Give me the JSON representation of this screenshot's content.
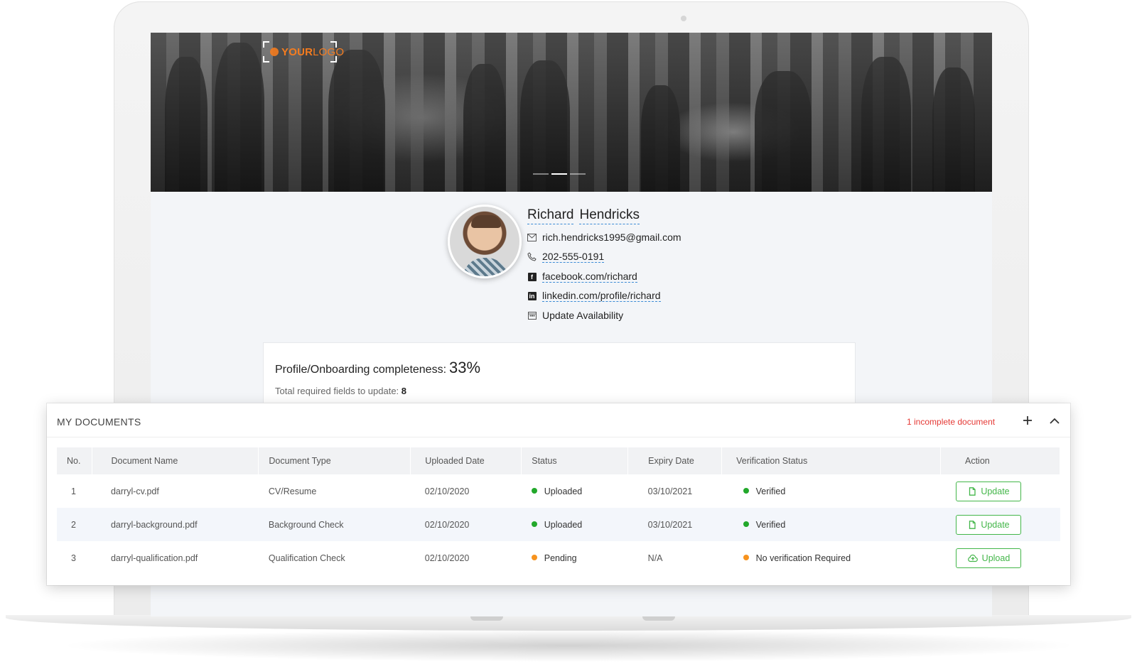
{
  "brand": {
    "logo_main": "YOUR",
    "logo_sub": "LOGO",
    "accent_color": "#f57c1f"
  },
  "profile": {
    "first_name": "Richard",
    "last_name": "Hendricks",
    "email": "rich.hendricks1995@gmail.com",
    "phone": "202-555-0191",
    "facebook": "facebook.com/richard",
    "linkedin": "linkedin.com/profile/richard",
    "availability": "Update Availability"
  },
  "completeness": {
    "label": "Profile/Onboarding completeness:",
    "percent": "33%",
    "required_label": "Total required fields to update:",
    "required_count": "8"
  },
  "documents": {
    "title": "MY DOCUMENTS",
    "warning": "1 incomplete document",
    "warning_color": "#e53935",
    "columns": {
      "no": "No.",
      "name": "Document Name",
      "type": "Document Type",
      "uploaded": "Uploaded Date",
      "status": "Status",
      "expiry": "Expiry Date",
      "verification": "Verification Status",
      "action": "Action"
    },
    "rows": [
      {
        "no": "1",
        "name": "darryl-cv.pdf",
        "type": "CV/Resume",
        "uploaded": "02/10/2020",
        "status": "Uploaded",
        "expiry": "03/10/2021",
        "verification": "Verified",
        "action": "Update"
      },
      {
        "no": "2",
        "name": "darryl-background.pdf",
        "type": "Background Check",
        "uploaded": "02/10/2020",
        "status": "Uploaded",
        "expiry": "03/10/2021",
        "verification": "Verified",
        "action": "Update"
      },
      {
        "no": "3",
        "name": "darryl-qualification.pdf",
        "type": "Qualification Check",
        "uploaded": "02/10/2020",
        "status": "Pending",
        "expiry": "N/A",
        "verification": "No verification Required",
        "action": "Upload"
      }
    ],
    "status_colors": {
      "ok": "#22a82b",
      "pending": "#f7931e"
    }
  }
}
